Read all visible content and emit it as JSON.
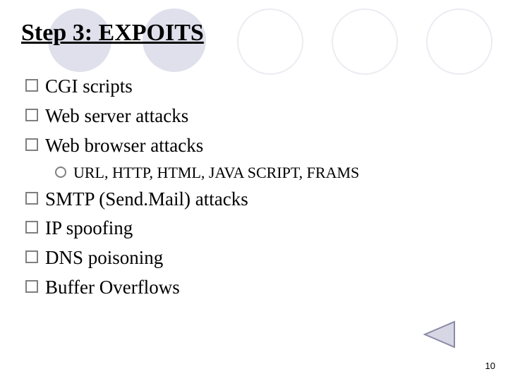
{
  "title": "Step 3: EXPOITS",
  "bullets": {
    "b1": "CGI scripts",
    "b2": "Web server attacks",
    "b3": " Web browser attacks",
    "b3a": "URL, HTTP, HTML, JAVA SCRIPT, FRAMS",
    "b4": "SMTP (Send.Mail) attacks",
    "b5": "IP spoofing",
    "b6": "DNS poisoning",
    "b7": "Buffer Overflows"
  },
  "page_number": "10",
  "theme": {
    "circle_fill": "#e0e0ec",
    "circle_stroke": "#d8d8e4",
    "nav_fill": "#d6d6e4",
    "nav_stroke": "#8a8aa6"
  }
}
